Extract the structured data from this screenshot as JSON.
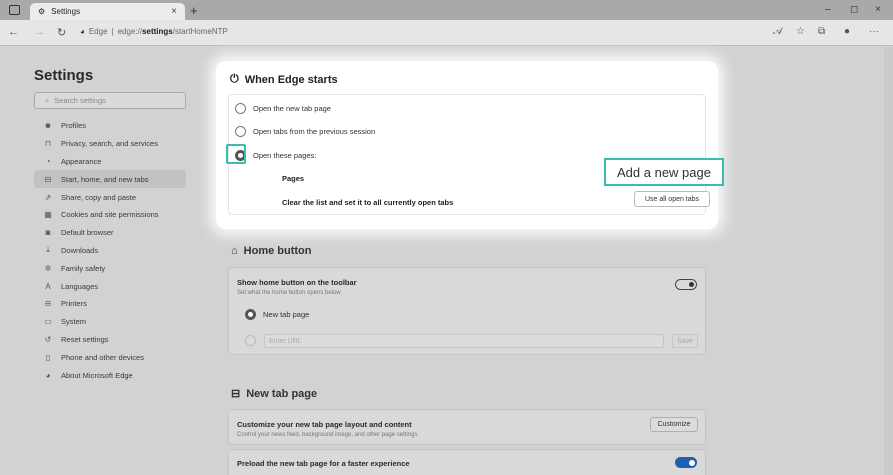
{
  "browser": {
    "tab_title": "Settings",
    "new_tab_symbol": "+",
    "url_site": "Edge",
    "url_path_prefix": "edge://",
    "url_path_bold": "settings",
    "url_path_suffix": "/startHomeNTP"
  },
  "sidebar": {
    "title": "Settings",
    "search_placeholder": "Search settings",
    "items": [
      {
        "label": "Profiles",
        "icon": "profile-icon",
        "glyph": "☻"
      },
      {
        "label": "Privacy, search, and services",
        "icon": "lock-icon",
        "glyph": "⊓"
      },
      {
        "label": "Appearance",
        "icon": "appearance-icon",
        "glyph": "◔"
      },
      {
        "label": "Start, home, and new tabs",
        "icon": "start-home-icon",
        "glyph": "⊟",
        "active": true
      },
      {
        "label": "Share, copy and paste",
        "icon": "share-icon",
        "glyph": "⇗"
      },
      {
        "label": "Cookies and site permissions",
        "icon": "cookies-icon",
        "glyph": "▦"
      },
      {
        "label": "Default browser",
        "icon": "default-browser-icon",
        "glyph": "◙"
      },
      {
        "label": "Downloads",
        "icon": "download-icon",
        "glyph": "⤓"
      },
      {
        "label": "Family safety",
        "icon": "family-icon",
        "glyph": "✲"
      },
      {
        "label": "Languages",
        "icon": "languages-icon",
        "glyph": "A"
      },
      {
        "label": "Printers",
        "icon": "printer-icon",
        "glyph": "⊖"
      },
      {
        "label": "System",
        "icon": "system-icon",
        "glyph": "▭"
      },
      {
        "label": "Reset settings",
        "icon": "reset-icon",
        "glyph": "↺"
      },
      {
        "label": "Phone and other devices",
        "icon": "phone-icon",
        "glyph": "▯"
      },
      {
        "label": "About Microsoft Edge",
        "icon": "edge-icon",
        "glyph": "◕"
      }
    ]
  },
  "when_edge_starts": {
    "title": "When Edge starts",
    "options": [
      "Open the new tab page",
      "Open tabs from the previous session",
      "Open these pages:"
    ],
    "pages_label": "Pages",
    "add_page_button": "Add a new page",
    "clear_label": "Clear the list and set it to all currently open tabs",
    "use_open_tabs_button": "Use all open tabs"
  },
  "home_button": {
    "title": "Home button",
    "show_label": "Show home button on the toolbar",
    "show_sub": "Set what the home button opens below",
    "new_tab_option": "New tab page",
    "url_placeholder": "Enter URL",
    "save_button": "Save"
  },
  "new_tab_page": {
    "title": "New tab page",
    "customize_label": "Customize your new tab page layout and content",
    "customize_sub": "Control your news feed, background image, and other page settings",
    "customize_button": "Customize",
    "preload_label": "Preload the new tab page for a faster experience"
  },
  "colors": {
    "highlight": "#3cbcae",
    "toggle_on": "#1f5fb0"
  }
}
